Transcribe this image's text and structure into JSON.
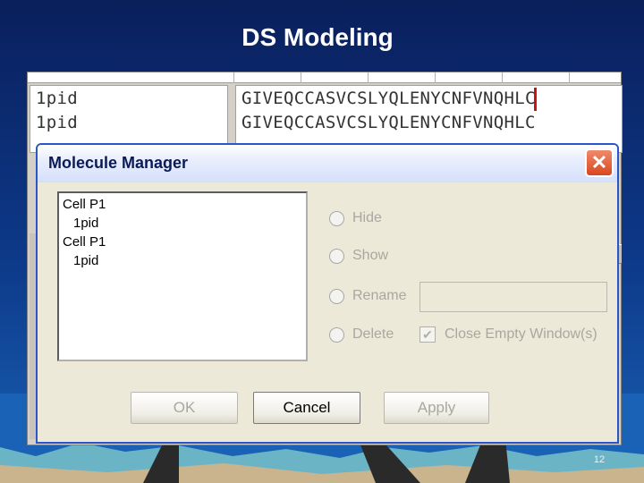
{
  "slide": {
    "title": "DS Modeling",
    "page_number": "12"
  },
  "sequence_viewer": {
    "rows": [
      {
        "name": "1pid",
        "sequence": "GIVEQCCASVCSLYQLENYCNFVNQHLC"
      },
      {
        "name": "1pid",
        "sequence": "GIVEQCCASVCSLYQLENYCNFVNQHLC"
      }
    ]
  },
  "dialog": {
    "title": "Molecule Manager",
    "close_icon": "close-icon",
    "molecule_list": [
      "Cell P1",
      "1pid",
      "Cell P1",
      "1pid"
    ],
    "options": {
      "hide": "Hide",
      "show": "Show",
      "rename": "Rename",
      "delete": "Delete"
    },
    "rename_value": "",
    "close_empty_label": "Close Empty Window(s)",
    "close_empty_checked": true,
    "buttons": {
      "ok": "OK",
      "cancel": "Cancel",
      "apply": "Apply"
    }
  },
  "colors": {
    "background": "#0d3a8a",
    "title_text": "#ffffff",
    "dialog_border": "#2a56c9",
    "close_button": "#d8471f",
    "sequence_cursor": "#d01010"
  }
}
